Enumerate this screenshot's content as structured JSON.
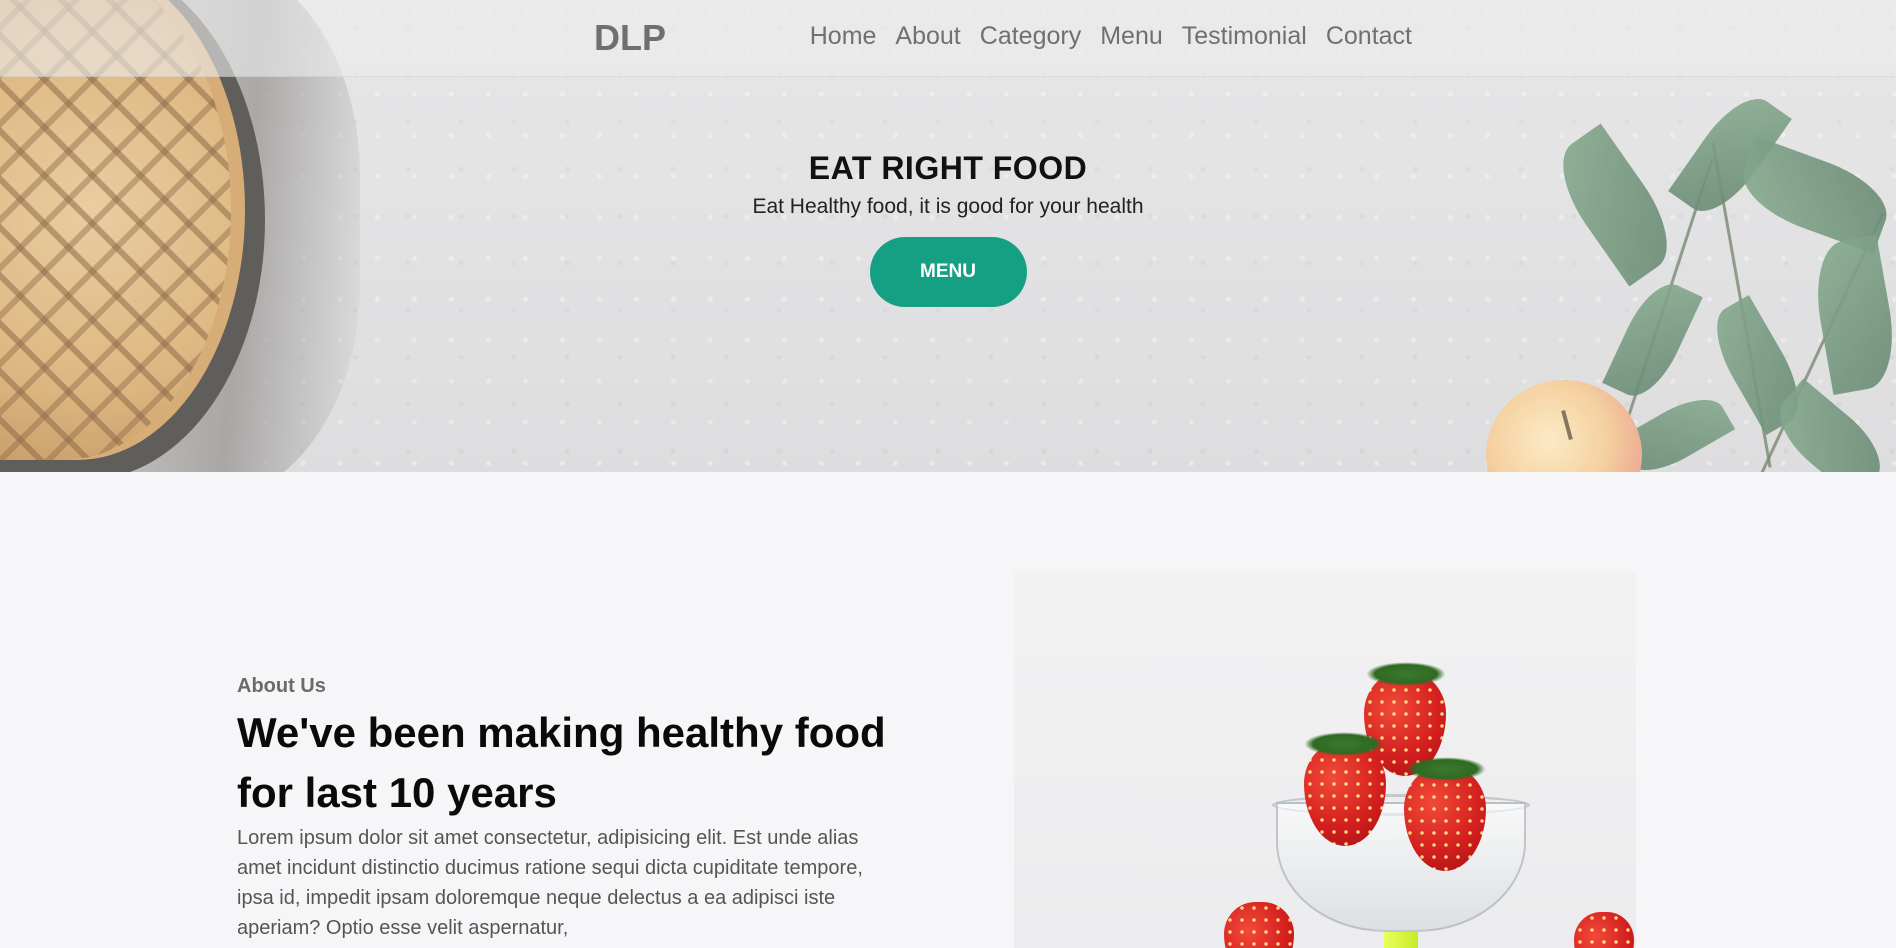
{
  "brand": "DLP",
  "nav": {
    "links": [
      "Home",
      "About",
      "Category",
      "Menu",
      "Testimonial",
      "Contact"
    ]
  },
  "hero": {
    "title": "EAT RIGHT FOOD",
    "subtitle": "Eat Healthy food, it is good for your health",
    "button_label": "MENU",
    "button_color": "#16a083"
  },
  "about": {
    "kicker": "About Us",
    "heading": "We've been making healthy food for last 10 years",
    "text": "Lorem ipsum dolor sit amet consectetur, adipisicing elit. Est unde alias amet incidunt distinctio ducimus ratione sequi dicta cupiditate tempore, ipsa id, impedit ipsam doloremque neque delectus a ea adipisci iste aperiam? Optio esse velit aspernatur,"
  }
}
